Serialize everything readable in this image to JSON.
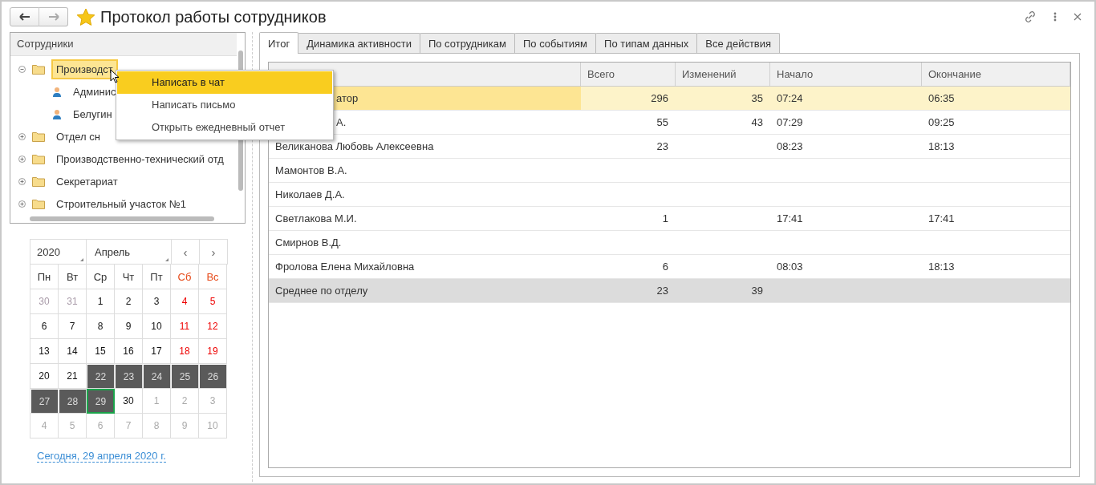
{
  "window": {
    "title": "Протокол работы сотрудников"
  },
  "tree": {
    "header": "Сотрудники",
    "items": [
      {
        "label": "Производст",
        "kind": "folder",
        "expanded": true,
        "selected": true,
        "children": [
          {
            "label": "Админис",
            "kind": "person",
            "selected": false
          },
          {
            "label": "Белугин",
            "kind": "person",
            "selected": false
          }
        ]
      },
      {
        "label": "Отдел сн",
        "kind": "folder",
        "expanded": false,
        "selected": false
      },
      {
        "label": "Производственно-технический отд",
        "kind": "folder",
        "expanded": false,
        "selected": false
      },
      {
        "label": "Секретариат",
        "kind": "folder",
        "expanded": false,
        "selected": false
      },
      {
        "label": "Строительный участок №1",
        "kind": "folder",
        "expanded": false,
        "selected": false
      }
    ]
  },
  "context_menu": [
    {
      "label": "Написать в чат",
      "selected": true
    },
    {
      "label": "Написать письмо",
      "selected": false
    },
    {
      "label": "Открыть ежедневный отчет",
      "selected": false
    }
  ],
  "calendar": {
    "year": "2020",
    "month": "Апрель",
    "prev": "‹",
    "next": "›",
    "weekdays": [
      {
        "label": "Пн",
        "kind": "work"
      },
      {
        "label": "Вт",
        "kind": "work"
      },
      {
        "label": "Ср",
        "kind": "work"
      },
      {
        "label": "Чт",
        "kind": "work"
      },
      {
        "label": "Пт",
        "kind": "work"
      },
      {
        "label": "Сб",
        "kind": "weekend"
      },
      {
        "label": "Вс",
        "kind": "weekend"
      }
    ],
    "days": [
      {
        "label": "30",
        "kind": "prev",
        "selected": false,
        "today": false
      },
      {
        "label": "31",
        "kind": "prev",
        "selected": false,
        "today": false
      },
      {
        "label": "1",
        "kind": "work",
        "selected": false,
        "today": false
      },
      {
        "label": "2",
        "kind": "work",
        "selected": false,
        "today": false
      },
      {
        "label": "3",
        "kind": "work",
        "selected": false,
        "today": false
      },
      {
        "label": "4",
        "kind": "weekend",
        "selected": false,
        "today": false
      },
      {
        "label": "5",
        "kind": "weekend",
        "selected": false,
        "today": false
      },
      {
        "label": "6",
        "kind": "work",
        "selected": false,
        "today": false
      },
      {
        "label": "7",
        "kind": "work",
        "selected": false,
        "today": false
      },
      {
        "label": "8",
        "kind": "work",
        "selected": false,
        "today": false
      },
      {
        "label": "9",
        "kind": "work",
        "selected": false,
        "today": false
      },
      {
        "label": "10",
        "kind": "work",
        "selected": false,
        "today": false
      },
      {
        "label": "11",
        "kind": "weekend",
        "selected": false,
        "today": false
      },
      {
        "label": "12",
        "kind": "weekend",
        "selected": false,
        "today": false
      },
      {
        "label": "13",
        "kind": "work",
        "selected": false,
        "today": false
      },
      {
        "label": "14",
        "kind": "work",
        "selected": false,
        "today": false
      },
      {
        "label": "15",
        "kind": "work",
        "selected": false,
        "today": false
      },
      {
        "label": "16",
        "kind": "work",
        "selected": false,
        "today": false
      },
      {
        "label": "17",
        "kind": "work",
        "selected": false,
        "today": false
      },
      {
        "label": "18",
        "kind": "weekend",
        "selected": false,
        "today": false
      },
      {
        "label": "19",
        "kind": "weekend",
        "selected": false,
        "today": false
      },
      {
        "label": "20",
        "kind": "work",
        "selected": false,
        "today": false
      },
      {
        "label": "21",
        "kind": "work",
        "selected": false,
        "today": false
      },
      {
        "label": "22",
        "kind": "work",
        "selected": true,
        "today": false
      },
      {
        "label": "23",
        "kind": "work",
        "selected": true,
        "today": false
      },
      {
        "label": "24",
        "kind": "work",
        "selected": true,
        "today": false
      },
      {
        "label": "25",
        "kind": "weekend",
        "selected": true,
        "today": false
      },
      {
        "label": "26",
        "kind": "weekend",
        "selected": true,
        "today": false
      },
      {
        "label": "27",
        "kind": "work",
        "selected": true,
        "today": false
      },
      {
        "label": "28",
        "kind": "work",
        "selected": true,
        "today": false
      },
      {
        "label": "29",
        "kind": "work",
        "selected": true,
        "today": true
      },
      {
        "label": "30",
        "kind": "work",
        "selected": false,
        "today": false
      },
      {
        "label": "1",
        "kind": "next",
        "selected": false,
        "today": false
      },
      {
        "label": "2",
        "kind": "next",
        "selected": false,
        "today": false
      },
      {
        "label": "3",
        "kind": "next",
        "selected": false,
        "today": false
      },
      {
        "label": "4",
        "kind": "next",
        "selected": false,
        "today": false
      },
      {
        "label": "5",
        "kind": "next",
        "selected": false,
        "today": false
      },
      {
        "label": "6",
        "kind": "next",
        "selected": false,
        "today": false
      },
      {
        "label": "7",
        "kind": "next",
        "selected": false,
        "today": false
      },
      {
        "label": "8",
        "kind": "next",
        "selected": false,
        "today": false
      },
      {
        "label": "9",
        "kind": "next",
        "selected": false,
        "today": false
      },
      {
        "label": "10",
        "kind": "next",
        "selected": false,
        "today": false
      }
    ],
    "today_link": "Сегодня, 29 апреля 2020 г."
  },
  "tabs": [
    {
      "label": "Итог",
      "selected": true
    },
    {
      "label": "Динамика активности",
      "selected": false
    },
    {
      "label": "По сотрудникам",
      "selected": false
    },
    {
      "label": "По событиям",
      "selected": false
    },
    {
      "label": "По типам данных",
      "selected": false
    },
    {
      "label": "Все действия",
      "selected": false
    }
  ],
  "table": {
    "columns": [
      "Всего",
      "Изменений",
      "Начало",
      "Окончание"
    ],
    "rows": [
      {
        "name": "атор",
        "kind": "covered",
        "selected": true,
        "cells": [
          "296",
          "35",
          "07:24",
          "06:35"
        ]
      },
      {
        "name": "А.",
        "kind": "covered",
        "selected": false,
        "cells": [
          "55",
          "43",
          "07:29",
          "09:25"
        ]
      },
      {
        "name": "Великанова Любовь Алексеевна",
        "kind": "row",
        "selected": false,
        "cells": [
          "23",
          "",
          "08:23",
          "18:13"
        ]
      },
      {
        "name": "Мамонтов В.А.",
        "kind": "row",
        "selected": false,
        "cells": [
          "",
          "",
          "",
          ""
        ]
      },
      {
        "name": "Николаев Д.А.",
        "kind": "row",
        "selected": false,
        "cells": [
          "",
          "",
          "",
          ""
        ]
      },
      {
        "name": "Светлакова М.И.",
        "kind": "row",
        "selected": false,
        "cells": [
          "1",
          "",
          "17:41",
          "17:41"
        ]
      },
      {
        "name": "Смирнов В.Д.",
        "kind": "row",
        "selected": false,
        "cells": [
          "",
          "",
          "",
          ""
        ]
      },
      {
        "name": "Фролова Елена Михайловна",
        "kind": "row",
        "selected": false,
        "cells": [
          "6",
          "",
          "08:03",
          "18:13"
        ]
      },
      {
        "name": "Среднее по отделу",
        "kind": "total",
        "selected": false,
        "cells": [
          "23",
          "39",
          "",
          ""
        ]
      }
    ]
  }
}
